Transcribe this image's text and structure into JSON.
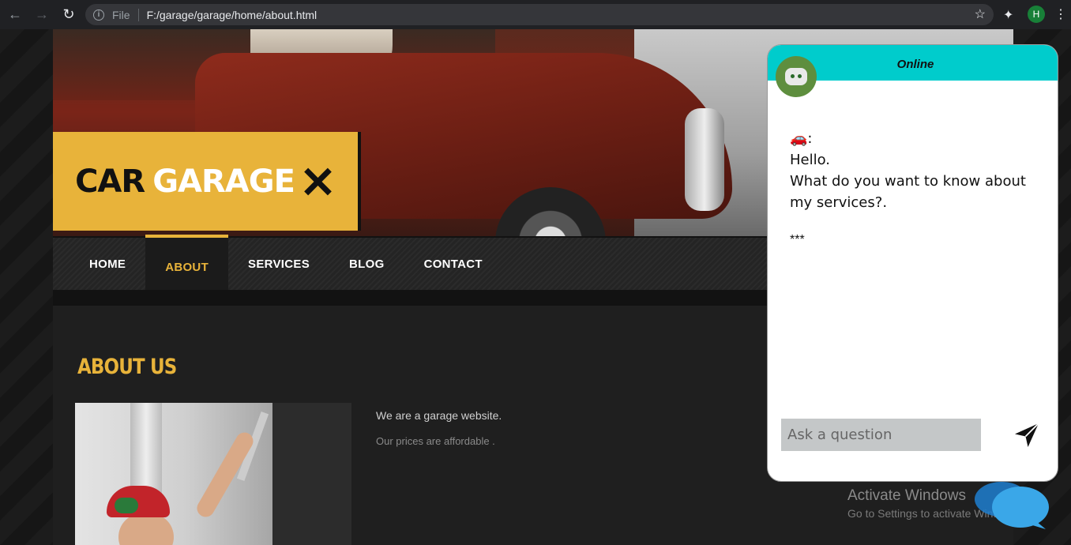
{
  "browser": {
    "file_label": "File",
    "url": "F:/garage/garage/home/about.html",
    "profile_initial": "H"
  },
  "logo": {
    "word1": "CAR",
    "word2": "GARAGE"
  },
  "nav": {
    "items": [
      "HOME",
      "ABOUT",
      "SERVICES",
      "BLOG",
      "CONTACT"
    ],
    "active": "ABOUT"
  },
  "about": {
    "title": "ABOUT US",
    "line1": "We are a garage website.",
    "line2": "Our prices are affordable ."
  },
  "chat": {
    "status": "Online",
    "message_prefix": "🚗:",
    "message_line1": "Hello.",
    "message_line2": "What do you want to know about my services?.",
    "stars": "***",
    "input_placeholder": "Ask a question"
  },
  "watermark": {
    "line1": "Activate Windows",
    "line2": "Go to Settings to activate Windows."
  },
  "colors": {
    "accent": "#e8b33a",
    "chat_header": "#00cccc"
  }
}
